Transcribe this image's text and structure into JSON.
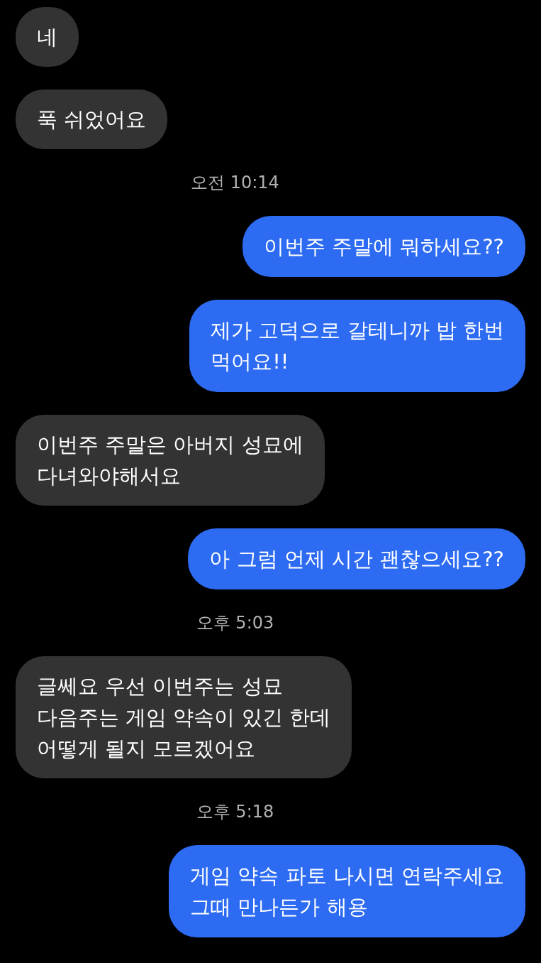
{
  "messages": [
    {
      "kind": "received",
      "text": "네"
    },
    {
      "kind": "received",
      "text": "푹 쉬었어요"
    },
    {
      "kind": "time",
      "text": "오전 10:14"
    },
    {
      "kind": "sent",
      "text": "이번주 주말에 뭐하세요??"
    },
    {
      "kind": "sent",
      "text": "제가 고덕으로 갈테니까 밥 한번\n먹어요!!"
    },
    {
      "kind": "received",
      "text": "이번주 주말은 아버지 성묘에\n다녀와야해서요"
    },
    {
      "kind": "sent",
      "text": "아 그럼 언제 시간 괜찮으세요??"
    },
    {
      "kind": "time",
      "text": "오후 5:03"
    },
    {
      "kind": "received",
      "text": "글쎄요 우선 이번주는 성묘\n다음주는 게임 약속이 있긴 한데\n어떻게 될지 모르겠어요"
    },
    {
      "kind": "time",
      "text": "오후 5:18"
    },
    {
      "kind": "sent",
      "text": "게임 약속 파토 나시면 연락주세요\n그때 만나든가 해용"
    }
  ]
}
